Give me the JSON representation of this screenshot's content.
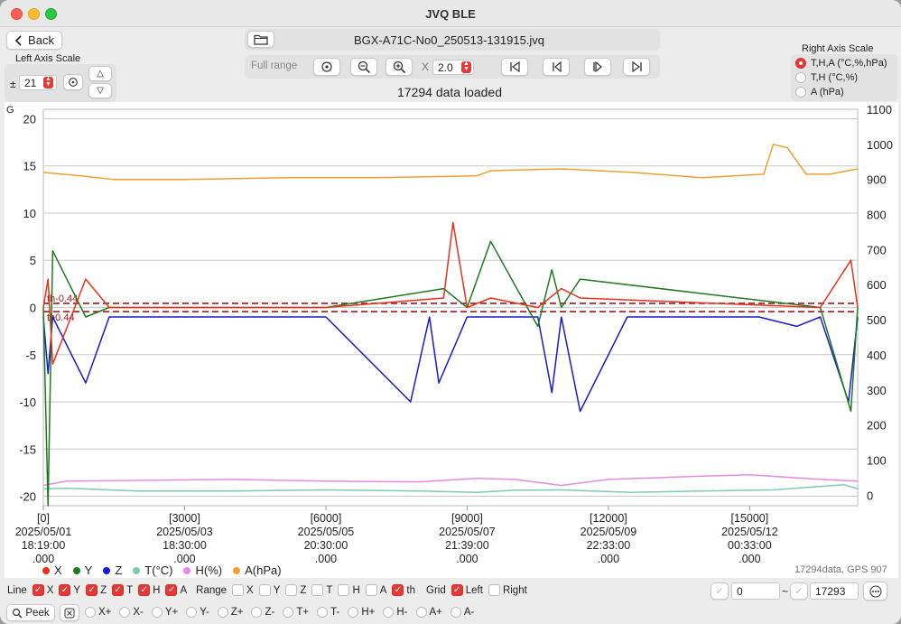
{
  "window": {
    "title": "JVQ BLE"
  },
  "toolbar": {
    "back_label": "Back",
    "filename": "BGX-A71C-No0_250513-131915.jvq",
    "full_range_label": "Full range",
    "zoom_x_label": "X",
    "zoom_x_value": "2.0",
    "status_text": "17294 data loaded"
  },
  "left_axis": {
    "title": "Left Axis Scale",
    "pm_symbol": "±",
    "value": "21",
    "up_arrow": "△",
    "down_arrow": "▽"
  },
  "right_axis": {
    "title": "Right Axis Scale",
    "options": [
      {
        "label": "T,H,A (°C,%,hPa)",
        "selected": true
      },
      {
        "label": "T,H (°C,%)",
        "selected": false
      },
      {
        "label": "A (hPa)",
        "selected": false
      }
    ]
  },
  "icons": {
    "back": "chevron-left-icon",
    "folder": "folder-icon",
    "reset": "reset-icon",
    "zoom_out": "zoom-out-icon",
    "zoom_in": "zoom-in-icon",
    "first": "skip-first-icon",
    "prev": "step-back-icon",
    "next": "step-forward-icon",
    "last": "skip-last-icon",
    "more": "more-icon",
    "peek": "magnifier-icon",
    "clear": "clear-icon"
  },
  "colors": {
    "X": "#e8311f",
    "Y": "#1f7a1f",
    "Z": "#1a1acc",
    "T": "#7fcbb0",
    "H": "#e48be4",
    "A": "#f0a030",
    "accent": "#e53935",
    "threshold": "#a01818"
  },
  "chart_data": {
    "type": "line",
    "left_unit_label": "G",
    "left_ylim": [
      -21,
      21
    ],
    "left_ticks": [
      "20",
      "15",
      "10",
      "5",
      "0",
      "-5",
      "-10",
      "-15",
      "-20"
    ],
    "right_ylim": [
      -30,
      1100
    ],
    "right_ticks": [
      "1100",
      "1000",
      "900",
      "800",
      "700",
      "600",
      "500",
      "400",
      "300",
      "200",
      "100",
      "0"
    ],
    "x_ticks": [
      {
        "index": "[0]",
        "date": "2025/05/01",
        "time": "18:19:00",
        "ms": ".000"
      },
      {
        "index": "[3000]",
        "date": "2025/05/03",
        "time": "18:30:00",
        "ms": ".000"
      },
      {
        "index": "[6000]",
        "date": "2025/05/05",
        "time": "20:30:00",
        "ms": ".000"
      },
      {
        "index": "[9000]",
        "date": "2025/05/07",
        "time": "21:39:00",
        "ms": ".000"
      },
      {
        "index": "[12000]",
        "date": "2025/05/09",
        "time": "22:33:00",
        "ms": ".000"
      },
      {
        "index": "[15000]",
        "date": "2025/05/12",
        "time": "00:33:00",
        "ms": ".000"
      }
    ],
    "xlim": [
      0,
      17293
    ],
    "grid": true,
    "thresholds": {
      "upper_label": "th-0.44",
      "lower_label": "th0.44",
      "values": [
        0.44,
        -0.44
      ]
    },
    "series": [
      {
        "name": "A(hPa)",
        "axis": "right",
        "x": [
          0,
          800,
          1500,
          3000,
          5200,
          7000,
          9200,
          9500,
          11000,
          12500,
          14000,
          15300,
          15500,
          15800,
          16200,
          16700,
          17293
        ],
        "values": [
          920,
          910,
          900,
          900,
          905,
          905,
          910,
          925,
          930,
          920,
          905,
          915,
          1000,
          990,
          915,
          915,
          930
        ]
      },
      {
        "name": "H(%)",
        "axis": "right",
        "x": [
          0,
          500,
          2000,
          4000,
          6000,
          8000,
          9200,
          10000,
          11000,
          12000,
          13500,
          15000,
          16500,
          17293
        ],
        "values": [
          28,
          40,
          42,
          45,
          40,
          38,
          48,
          45,
          28,
          45,
          52,
          58,
          45,
          40
        ]
      },
      {
        "name": "T(°C)",
        "axis": "right",
        "x": [
          0,
          500,
          2000,
          4000,
          6000,
          8000,
          9200,
          10000,
          11000,
          12500,
          14000,
          15500,
          17000,
          17293
        ],
        "values": [
          18,
          20,
          12,
          12,
          15,
          12,
          8,
          14,
          15,
          8,
          12,
          15,
          30,
          18
        ]
      },
      {
        "name": "Z",
        "axis": "left",
        "x": [
          0,
          100,
          200,
          900,
          1400,
          3000,
          6000,
          7800,
          8200,
          8400,
          9000,
          10500,
          10800,
          11000,
          11400,
          12400,
          15200,
          16000,
          16500,
          17100,
          17293
        ],
        "values": [
          -1,
          -7,
          -1,
          -8,
          -1,
          -1,
          -1,
          -10,
          -1,
          -8,
          -1,
          -1,
          -9,
          -1,
          -11,
          -1,
          -1,
          -2,
          -1,
          -10,
          -1
        ]
      },
      {
        "name": "Y",
        "axis": "left",
        "x": [
          0,
          100,
          200,
          900,
          1400,
          6000,
          8500,
          9000,
          9500,
          10500,
          10800,
          11000,
          11400,
          16500,
          17150,
          17293
        ],
        "values": [
          0,
          -21,
          6,
          -1,
          0,
          0,
          2,
          0,
          7,
          -2,
          4,
          0,
          3,
          0,
          -11,
          0
        ]
      },
      {
        "name": "X",
        "axis": "left",
        "x": [
          0,
          100,
          200,
          900,
          1400,
          6000,
          8500,
          8700,
          9000,
          9500,
          10500,
          11000,
          11400,
          16500,
          17150,
          17293
        ],
        "values": [
          0,
          3,
          -6,
          3,
          0,
          0,
          1,
          9,
          0,
          1,
          0,
          2,
          1,
          0,
          5,
          0
        ]
      }
    ]
  },
  "legend": [
    "X",
    "Y",
    "Z",
    "T(°C)",
    "H(%)",
    "A(hPa)"
  ],
  "data_info": "17294data, GPS 907",
  "controls": {
    "line_label": "Line",
    "line_items": [
      {
        "label": "X",
        "checked": true
      },
      {
        "label": "Y",
        "checked": true
      },
      {
        "label": "Z",
        "checked": true
      },
      {
        "label": "T",
        "checked": true
      },
      {
        "label": "H",
        "checked": true
      },
      {
        "label": "A",
        "checked": true
      }
    ],
    "range_label": "Range",
    "range_items": [
      {
        "label": "X",
        "checked": false
      },
      {
        "label": "Y",
        "checked": false
      },
      {
        "label": "Z",
        "checked": false
      },
      {
        "label": "T",
        "checked": false
      },
      {
        "label": "H",
        "checked": false
      },
      {
        "label": "A",
        "checked": false
      },
      {
        "label": "th",
        "checked": true
      }
    ],
    "grid_label": "Grid",
    "grid_items": [
      {
        "label": "Left",
        "checked": true
      },
      {
        "label": "Right",
        "checked": false
      }
    ],
    "range_from": "0",
    "range_sep": "~",
    "range_to": "17293",
    "peek_label": "Peek",
    "peek_options": [
      "X+",
      "X-",
      "Y+",
      "Y-",
      "Z+",
      "Z-",
      "T+",
      "T-",
      "H+",
      "H-",
      "A+",
      "A-"
    ]
  }
}
